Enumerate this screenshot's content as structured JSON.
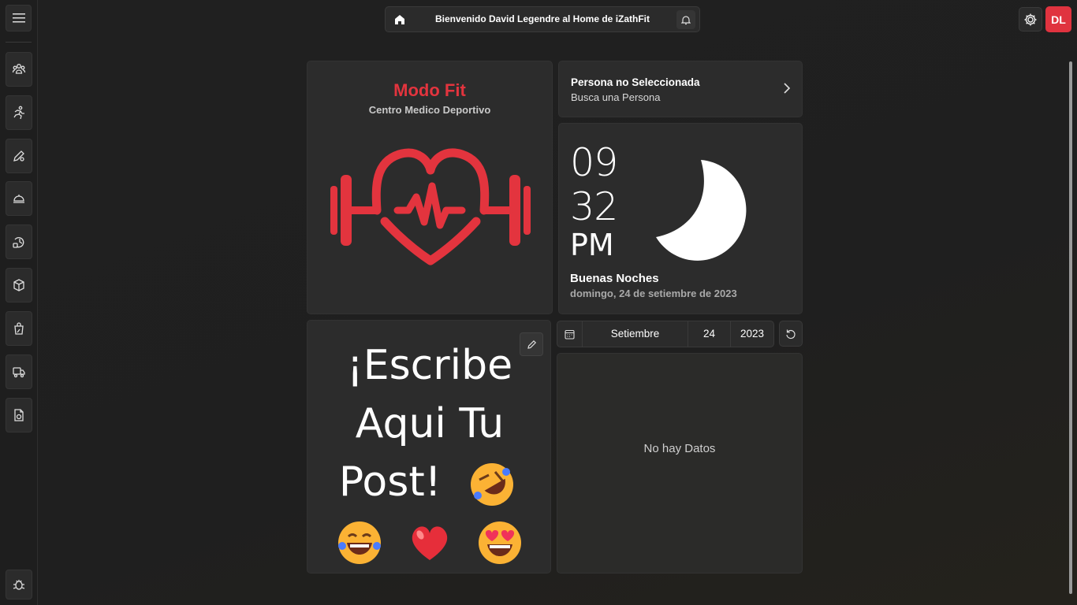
{
  "header": {
    "title": "Bienvenido David Legendre al Home de iZathFit",
    "avatar_initials": "DL",
    "avatar_color": "#e0333f"
  },
  "sidebar": {
    "items": [
      {
        "icon": "people-icon"
      },
      {
        "icon": "running-person-icon"
      },
      {
        "icon": "edit-settings-icon"
      },
      {
        "icon": "service-bell-icon"
      },
      {
        "icon": "history-lock-icon"
      },
      {
        "icon": "box-icon"
      },
      {
        "icon": "shopping-bag-percent-icon"
      },
      {
        "icon": "truck-icon"
      },
      {
        "icon": "document-sync-icon"
      }
    ],
    "bottom_icon": "bug-icon"
  },
  "brand": {
    "name": "Modo Fit",
    "subtitle": "Centro Medico Deportivo",
    "color": "#e3343e"
  },
  "person": {
    "title": "Persona no Seleccionada",
    "subtitle": "Busca una Persona"
  },
  "clock": {
    "hours": "09",
    "minutes": "32",
    "ampm": "PM",
    "greeting": "Buenas Noches",
    "date": "domingo, 24 de setiembre de 2023"
  },
  "post": {
    "line1": "¡Escribe",
    "line2": "Aqui Tu",
    "line3": "Post!"
  },
  "date_selector": {
    "month": "Setiembre",
    "day": "24",
    "year": "2023"
  },
  "data_panel": {
    "empty_text": "No hay Datos"
  }
}
